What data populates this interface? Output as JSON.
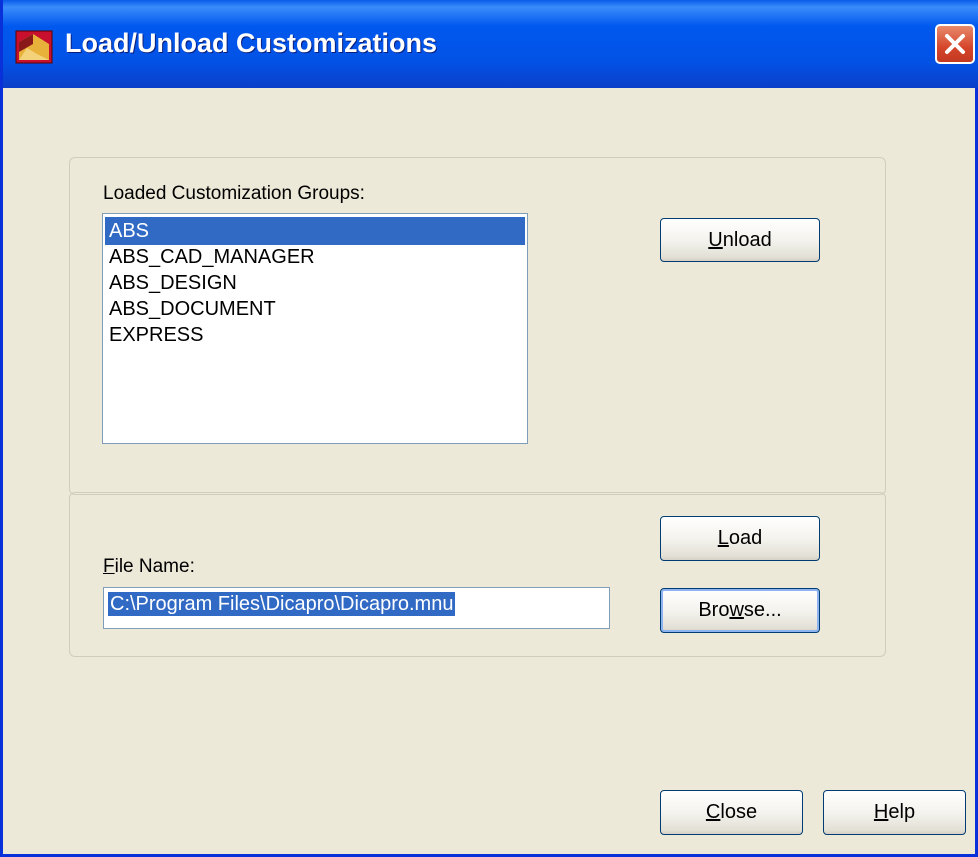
{
  "window": {
    "title": "Load/Unload Customizations",
    "icon": "autocad-app-icon",
    "close_icon": "close-icon"
  },
  "groups_section": {
    "label": "Loaded Customization Groups:",
    "items": [
      "ABS",
      "ABS_CAD_MANAGER",
      "ABS_DESIGN",
      "ABS_DOCUMENT",
      "EXPRESS"
    ],
    "selected_index": 0,
    "unload_button": {
      "mnemonic": "U",
      "rest": "nload"
    }
  },
  "file_section": {
    "label_mnemonic": "F",
    "label_rest": "ile Name:",
    "file_name_value": "C:\\Program Files\\Dicapro\\Dicapro.mnu",
    "load_button": {
      "mnemonic": "L",
      "rest": "oad"
    },
    "browse_button": {
      "before": "Bro",
      "mnemonic": "w",
      "after": "se..."
    }
  },
  "footer": {
    "close_button": {
      "mnemonic": "C",
      "rest": "lose"
    },
    "help_button": {
      "mnemonic": "H",
      "rest": "elp"
    }
  },
  "colors": {
    "titlebar": "#0058EE",
    "dialog_bg": "#ECE9D8",
    "selection": "#316AC5",
    "close_button": "#D6452A"
  }
}
